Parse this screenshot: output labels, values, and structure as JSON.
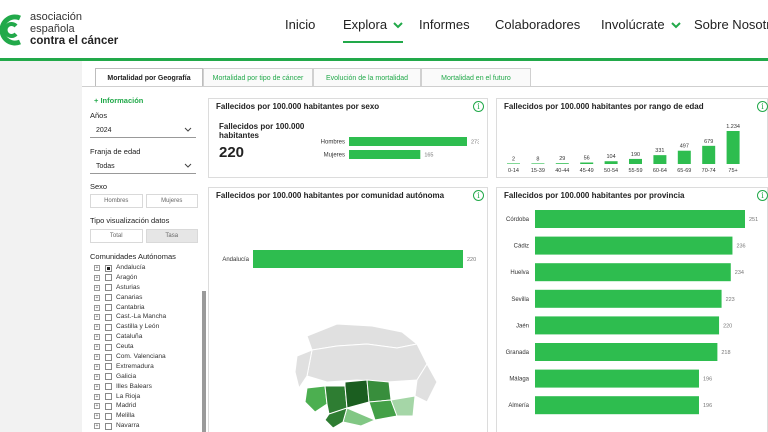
{
  "logo": {
    "line1": "asociación",
    "line2": "española",
    "line3": "contra el cáncer"
  },
  "nav": {
    "items": [
      {
        "label": "Inicio",
        "active": false,
        "chevron": false
      },
      {
        "label": "Explora",
        "active": true,
        "chevron": true
      },
      {
        "label": "Informes",
        "active": false,
        "chevron": false
      },
      {
        "label": "Colaboradores",
        "active": false,
        "chevron": false
      },
      {
        "label": "Involúcrate",
        "active": false,
        "chevron": true
      },
      {
        "label": "Sobre Nosotros",
        "active": false,
        "chevron": false
      }
    ]
  },
  "colors": {
    "accent": "#22a94a",
    "bar": "#2ebd4f",
    "map_dark": "#2e7d32",
    "map_mid": "#4caf50",
    "map_light": "#a5d6a7",
    "map_base": "#e0e0e0"
  },
  "tabs": [
    {
      "label": "Mortalidad por Geografía",
      "active": true
    },
    {
      "label": "Mortalidad por tipo de cáncer",
      "active": false
    },
    {
      "label": "Evolución de la mortalidad",
      "active": false
    },
    {
      "label": "Mortalidad en el futuro",
      "active": false
    }
  ],
  "filters": {
    "more_info": "+ Información",
    "year_label": "Años",
    "year_value": "2024",
    "age_label": "Franja de edad",
    "age_value": "Todas",
    "sex_label": "Sexo",
    "sex_options": [
      "Hombres",
      "Mujeres"
    ],
    "viz_label": "Tipo visualización datos",
    "viz_options": [
      {
        "label": "Total",
        "selected": false
      },
      {
        "label": "Tasa",
        "selected": true
      }
    ],
    "regions_label": "Comunidades Autónomas",
    "regions": [
      {
        "name": "Andalucía",
        "checked": true
      },
      {
        "name": "Aragón",
        "checked": false
      },
      {
        "name": "Asturias",
        "checked": false
      },
      {
        "name": "Canarias",
        "checked": false
      },
      {
        "name": "Cantabria",
        "checked": false
      },
      {
        "name": "Cast.-La Mancha",
        "checked": false
      },
      {
        "name": "Castilla y León",
        "checked": false
      },
      {
        "name": "Cataluña",
        "checked": false
      },
      {
        "name": "Ceuta",
        "checked": false
      },
      {
        "name": "Com. Valenciana",
        "checked": false
      },
      {
        "name": "Extremadura",
        "checked": false
      },
      {
        "name": "Galicia",
        "checked": false
      },
      {
        "name": "Illes Balears",
        "checked": false
      },
      {
        "name": "La Rioja",
        "checked": false
      },
      {
        "name": "Madrid",
        "checked": false
      },
      {
        "name": "Melilla",
        "checked": false
      },
      {
        "name": "Navarra",
        "checked": false
      }
    ]
  },
  "panels": {
    "sex": {
      "title": "Fallecidos por 100.000 habitantes por sexo",
      "kpi_label": "Fallecidos por 100.000 habitantes",
      "kpi_value": "220"
    },
    "age": {
      "title": "Fallecidos por 100.000 habitantes por rango de edad"
    },
    "region": {
      "title": "Fallecidos por 100.000 habitantes por comunidad autónoma"
    },
    "province": {
      "title": "Fallecidos por 100.000 habitantes por provincia"
    }
  },
  "chart_data": [
    {
      "type": "bar",
      "orientation": "horizontal",
      "title": "Fallecidos por 100.000 habitantes por sexo",
      "categories": [
        "Hombres",
        "Mujeres"
      ],
      "values": [
        273,
        165
      ],
      "value_labels": [
        "273",
        "165"
      ]
    },
    {
      "type": "bar",
      "orientation": "vertical",
      "title": "Fallecidos por 100.000 habitantes por rango de edad",
      "categories": [
        "0-14",
        "15-39",
        "40-44",
        "45-49",
        "50-54",
        "55-59",
        "60-64",
        "65-69",
        "70-74",
        "75+"
      ],
      "values": [
        2,
        8,
        29,
        56,
        104,
        190,
        331,
        497,
        679,
        1234
      ],
      "value_labels": [
        "2",
        "8",
        "29",
        "56",
        "104",
        "190",
        "331",
        "497",
        "679",
        "1.234"
      ]
    },
    {
      "type": "bar",
      "orientation": "horizontal",
      "title": "Fallecidos por 100.000 habitantes por comunidad autónoma",
      "categories": [
        "Andalucía"
      ],
      "values": [
        220
      ],
      "value_labels": [
        "220"
      ]
    },
    {
      "type": "bar",
      "orientation": "horizontal",
      "title": "Fallecidos por 100.000 habitantes por provincia",
      "categories": [
        "Córdoba",
        "Cádiz",
        "Huelva",
        "Sevilla",
        "Jaén",
        "Granada",
        "Málaga",
        "Almería"
      ],
      "values": [
        251,
        236,
        234,
        223,
        220,
        218,
        196,
        196
      ],
      "value_labels": [
        "251",
        "236",
        "234",
        "223",
        "220",
        "218",
        "196",
        "196"
      ]
    }
  ]
}
